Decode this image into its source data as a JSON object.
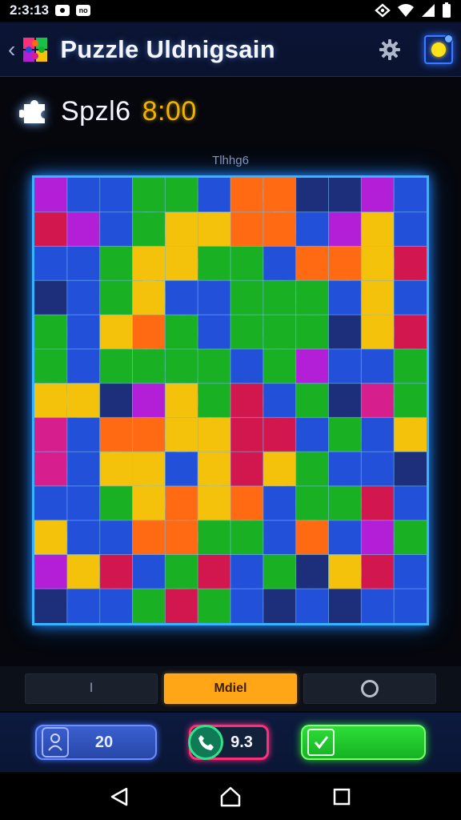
{
  "status_bar": {
    "time": "2:3:13",
    "left_badges": [
      "notification-dot-icon",
      "nfc-badge-icon"
    ],
    "right_icons": [
      "hotspot-icon",
      "wifi-icon",
      "cell-signal-icon",
      "battery-icon"
    ],
    "badge_text": "no"
  },
  "header": {
    "title": "Puzzle Uldnigsain",
    "back_icon": "chevron-left-icon",
    "app_icon": "puzzle-piece-colorful-icon",
    "settings_icon": "gear-icon",
    "corner_icon": "coin-icon"
  },
  "game_status": {
    "player": "Spzl6",
    "timer": "8:00",
    "icon": "puzzle-piece-icon"
  },
  "board": {
    "caption": "Tlhhg6",
    "rows": 13,
    "cols": 12,
    "palette": {
      "r": "#d2174f",
      "p": "#b31fd6",
      "b": "#2350d8",
      "g": "#19b024",
      "y": "#f5c20b",
      "o": "#ff6a12",
      "t": "#1a6fbf",
      "m": "#d61f8c",
      "d": "#1d2f7a"
    },
    "tiles": [
      "pbbggbooddpb",
      "rpbgyyoobpyb",
      "bbgyyggbooyr",
      "dbgybbgggbyb",
      "gbyogbgggdyr",
      "gbggggbgpbbg",
      "yydpygrbgdmg",
      "mbooyyrrbgby",
      "mbyybyrygbbd",
      "bbgyoyobggrb",
      "ybbooggbobpg",
      "pyrbgrbgdyrb",
      "dbbgrgbdbdbb"
    ]
  },
  "mode_tabs": [
    {
      "label": "l",
      "active": false
    },
    {
      "label": "Mdiel",
      "active": true
    },
    {
      "label": "",
      "icon": "ring-icon",
      "active": false
    }
  ],
  "actions": {
    "score": {
      "value": "20",
      "icon": "person-icon"
    },
    "moves": {
      "value": "9.3",
      "icon": "phone-icon"
    },
    "confirm": {
      "icon": "check-square-icon"
    }
  },
  "nav": {
    "back_icon": "triangle-back-icon",
    "home_icon": "home-icon",
    "recents_icon": "square-recents-icon"
  }
}
